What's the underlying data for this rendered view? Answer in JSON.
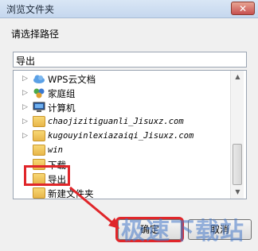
{
  "window": {
    "title": "浏览文件夹",
    "close_label": "✕"
  },
  "prompt": "请选择路径",
  "path_value": "导出",
  "tree": [
    {
      "label": "WPS云文档",
      "icon": "cloud-icon",
      "expandable": true
    },
    {
      "label": "家庭组",
      "icon": "homegroup-icon",
      "expandable": true
    },
    {
      "label": "计算机",
      "icon": "computer-icon",
      "expandable": true
    },
    {
      "label": "chaojizitiguanli_Jisuxz.com",
      "icon": "folder-icon",
      "expandable": true
    },
    {
      "label": "kugouyinlexiazaiqi_Jisuxz.com",
      "icon": "folder-icon",
      "expandable": true
    },
    {
      "label": "win",
      "icon": "folder-icon",
      "expandable": false
    },
    {
      "label": "下载",
      "icon": "folder-icon",
      "expandable": false
    },
    {
      "label": "导出",
      "icon": "folder-icon",
      "expandable": false,
      "selected": true
    },
    {
      "label": "新建文件夹",
      "icon": "folder-icon",
      "expandable": false
    }
  ],
  "buttons": {
    "ok": "确定",
    "cancel": "取消"
  },
  "watermark": "极速下载站",
  "colors": {
    "highlight": "#e0262a",
    "folder": "#f0c35c"
  }
}
